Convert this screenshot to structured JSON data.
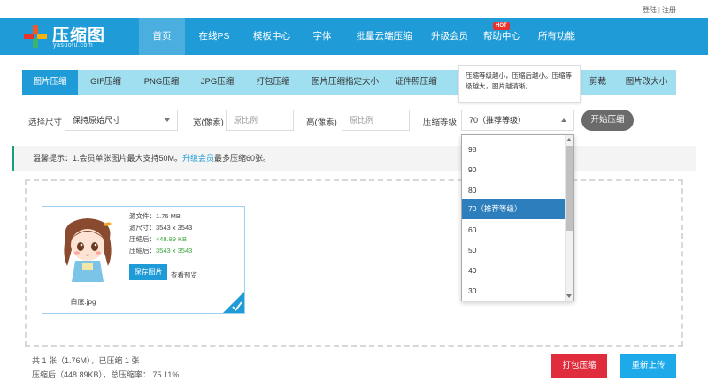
{
  "header": {
    "login": "登陆",
    "separator": "|",
    "register": "注册"
  },
  "logo": {
    "title": "压缩图",
    "subtitle": "yasuotu.com"
  },
  "nav": {
    "items": [
      {
        "label": "首页"
      },
      {
        "label": "在线PS"
      },
      {
        "label": "模板中心"
      },
      {
        "label": "字体"
      },
      {
        "label": "批量云端压缩"
      },
      {
        "label": "升级会员"
      },
      {
        "label": "帮助中心"
      },
      {
        "label": "所有功能"
      }
    ],
    "hot_badge": "HOT"
  },
  "tabs": [
    {
      "label": "图片压缩"
    },
    {
      "label": "GIF压缩"
    },
    {
      "label": "PNG压缩"
    },
    {
      "label": "JPG压缩"
    },
    {
      "label": "打包压缩"
    },
    {
      "label": "图片压缩指定大小"
    },
    {
      "label": "证件照压缩"
    },
    {
      "label": "剪裁"
    },
    {
      "label": "图片改大小"
    }
  ],
  "tooltip": {
    "text": "压缩等级越小，压缩后越小。压缩等级越大，图片越清晰。"
  },
  "options": {
    "size_label": "选择尺寸",
    "size_value": "保持原始尺寸",
    "width_label": "宽(像素)",
    "width_placeholder": "原比例",
    "height_label": "高(像素)",
    "height_placeholder": "原比例",
    "level_label": "压缩等级",
    "level_value": "70（推荐等级）",
    "start_button": "开始压缩"
  },
  "notice": {
    "prefix": "温馨提示：1.会员单张图片最大支持50M。",
    "link": "升级会员",
    "suffix": "最多压缩60张。"
  },
  "file_card": {
    "filename": "白底.jpg",
    "source_file_label": "源文件：",
    "source_file_value": "1.76 MB",
    "source_size_label": "源尺寸：",
    "source_size_value": "3543 x 3543",
    "compressed_label": "压缩后：",
    "compressed_value": "448.89 KB",
    "compressed_size_label": "压缩后：",
    "compressed_size_value": "3543 x 3543",
    "save_button": "保存图片",
    "preview_link": "查看预览"
  },
  "footer": {
    "summary_line1": "共 1 张（1.76M），已压缩 1 张",
    "summary_line2": "压缩后（448.89KB），总压缩率： 75.11%",
    "pack_button": "打包压缩",
    "reupload_button": "重新上传"
  },
  "dropdown": {
    "options": [
      {
        "label": "98",
        "selected": false
      },
      {
        "label": "90",
        "selected": false
      },
      {
        "label": "80",
        "selected": false
      },
      {
        "label": "70（推荐等级）",
        "selected": true
      },
      {
        "label": "60",
        "selected": false
      },
      {
        "label": "50",
        "selected": false
      },
      {
        "label": "40",
        "selected": false
      },
      {
        "label": "30",
        "selected": false
      }
    ]
  },
  "colors": {
    "brand_blue": "#1f9bd7",
    "nav_active": "#4aaedf",
    "tab_bar": "#a0dff0",
    "selected_option": "#2d7ebc",
    "pack_button": "#e02d3d",
    "reupload_button": "#1eaaea",
    "notice_accent": "#18a07c",
    "green_text": "#3fa43f",
    "hot_badge": "#e8322b"
  }
}
